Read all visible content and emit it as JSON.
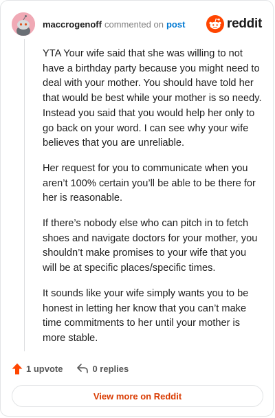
{
  "header": {
    "username": "maccrogenoff",
    "action_text": "commented on",
    "post_link": "post",
    "brand": "reddit"
  },
  "comment": {
    "paragraphs": [
      "YTA Your wife said that she was willing to not have a birthday party because you might need to deal with your mother. You should have told her that would be best while your mother is so needy. Instead you said that you would help her only to go back on your word. I can see why your wife believes that you are unreliable.",
      "Her request for you to communicate when you aren’t 100% certain you’ll be able to be there for her is reasonable.",
      "If there’s nobody else who can pitch in to fetch shoes and navigate doctors for your mother, you shouldn’t make promises to your wife that you will be at specific places/specific times.",
      "It sounds like your wife simply wants you to be honest in letting her know that you can’t make time commitments to her until your mother is more stable."
    ]
  },
  "actions": {
    "upvotes": "1 upvote",
    "replies": "0 replies"
  },
  "footer": {
    "view_more": "View more on Reddit"
  },
  "colors": {
    "reddit_orange": "#ff4500",
    "link_blue": "#0079d3",
    "view_more_text": "#d93a00",
    "avatar_bg": "#f0a9b5"
  },
  "icons": {
    "avatar": "snoo-avatar",
    "brand": "reddit-logo-icon",
    "upvote": "upvote-arrow-icon",
    "reply": "reply-arrow-icon"
  }
}
